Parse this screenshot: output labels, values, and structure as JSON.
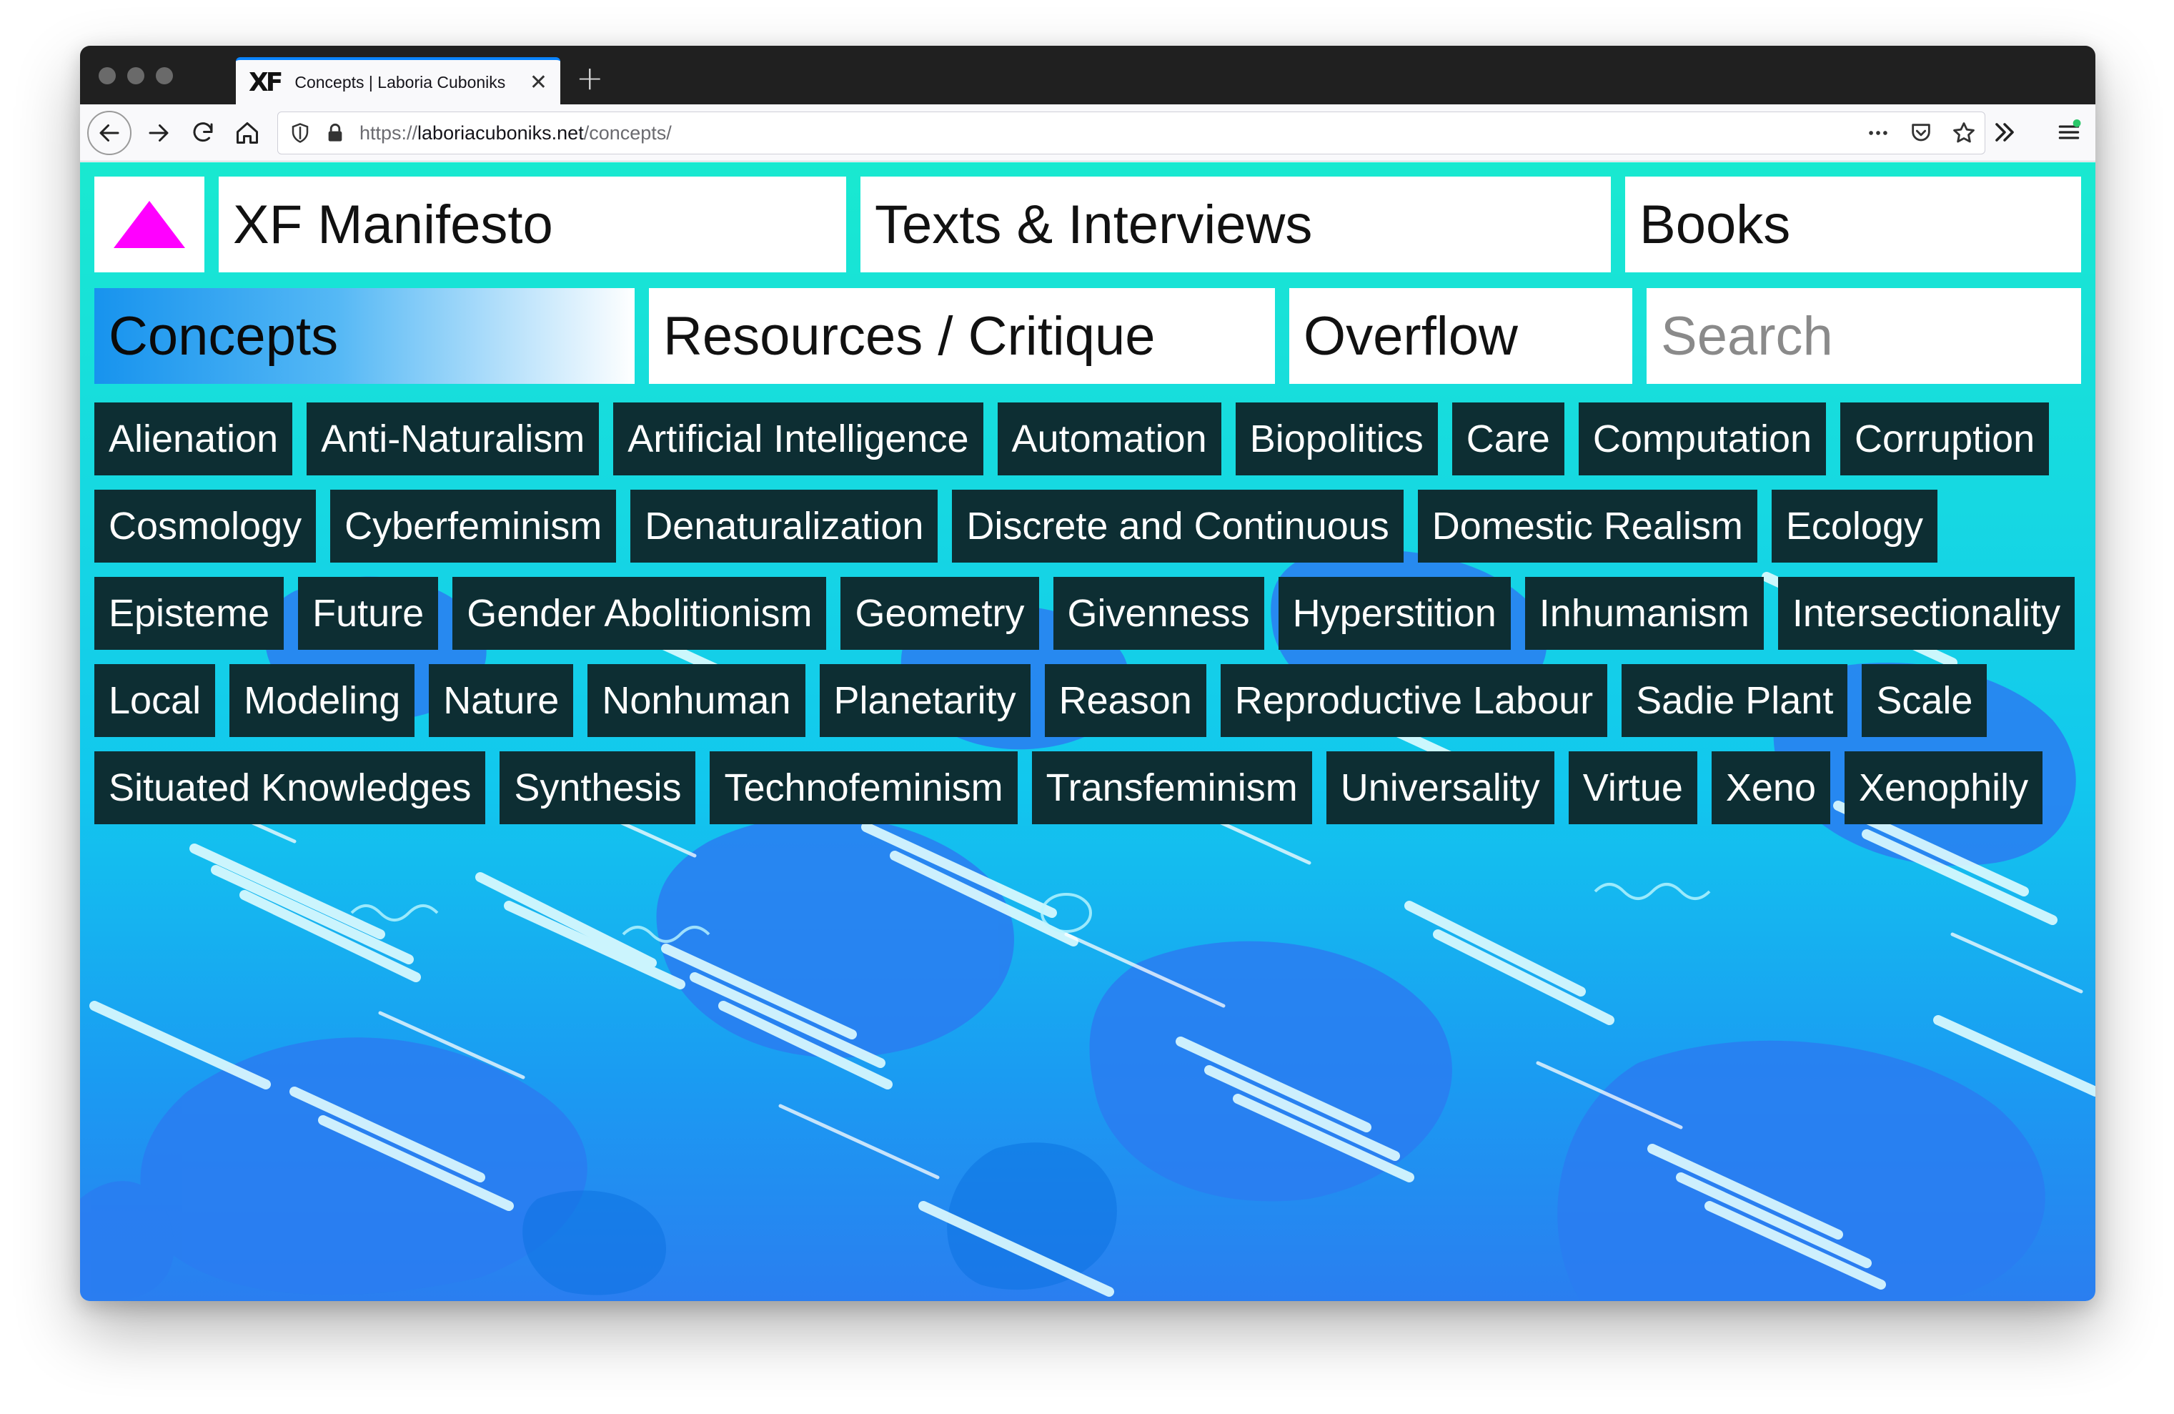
{
  "browser": {
    "tab_favicon": "XF",
    "tab_title": "Concepts | Laboria Cuboniks",
    "url_scheme": "https://",
    "url_host": "laboriacuboniks.net",
    "url_path": "/concepts/",
    "icons": {
      "back": "arrow-left-icon",
      "forward": "arrow-right-icon",
      "reload": "reload-icon",
      "home": "home-icon",
      "tracking": "shield-icon",
      "lock": "lock-icon",
      "more": "ellipsis-icon",
      "pocket": "pocket-icon",
      "bookmark": "star-icon",
      "overflow": "chevron-double-right-icon",
      "menu": "hamburger-icon"
    }
  },
  "site": {
    "logo": "triangle-logo",
    "logo_color": "#ff00ff",
    "nav": {
      "manifesto": "XF Manifesto",
      "texts": "Texts & Interviews",
      "books": "Books",
      "concepts": "Concepts",
      "resources": "Resources / Critique",
      "overflow": "Overflow"
    },
    "search_placeholder": "Search",
    "concept_rows": [
      [
        "Alienation",
        "Anti-Naturalism",
        "Artificial Intelligence",
        "Automation",
        "Biopolitics",
        "Care",
        "Computation",
        "Corruption"
      ],
      [
        "Cosmology",
        "Cyberfeminism",
        "Denaturalization",
        "Discrete and Continuous",
        "Domestic Realism",
        "Ecology"
      ],
      [
        "Episteme",
        "Future",
        "Gender Abolitionism",
        "Geometry",
        "Givenness",
        "Hyperstition",
        "Inhumanism",
        "Intersectionality"
      ],
      [
        "Local",
        "Modeling",
        "Nature",
        "Nonhuman",
        "Planetarity",
        "Reason",
        "Reproductive Labour",
        "Sadie Plant",
        "Scale"
      ],
      [
        "Situated Knowledges",
        "Synthesis",
        "Technofeminism",
        "Transfeminism",
        "Universality",
        "Virtue",
        "Xeno",
        "Xenophily"
      ]
    ]
  },
  "colors": {
    "chip_bg": "#0d2e33",
    "active_gradient_start": "#1793ee",
    "bg_top": "#19e9d0",
    "bg_bottom": "#2a7ef0"
  }
}
